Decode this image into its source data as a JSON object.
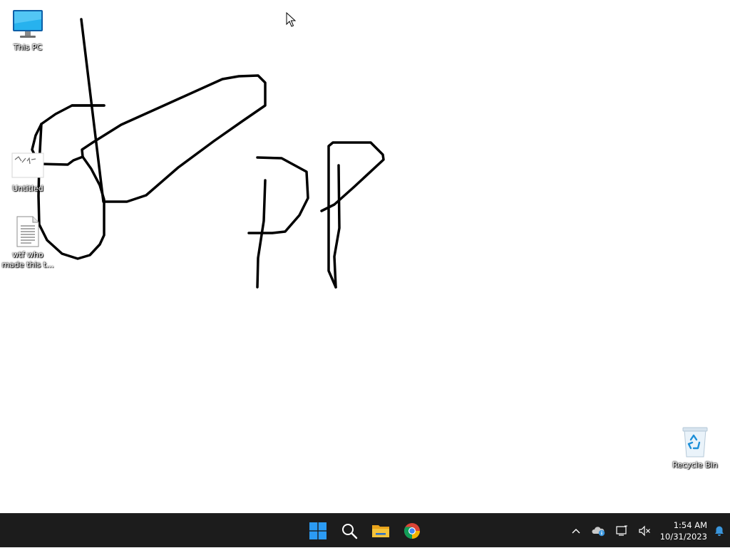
{
  "desktop": {
    "icons": [
      {
        "label": "This PC",
        "icon": "monitor-icon"
      },
      {
        "label": "Untitled",
        "icon": "paint-file-icon"
      },
      {
        "label": "wtf who made this t...",
        "icon": "text-document-icon"
      },
      {
        "label": "Recycle Bin",
        "icon": "recycle-bin-icon"
      }
    ]
  },
  "taskbar": {
    "pinned": [
      {
        "name": "Start",
        "icon": "windows-start-icon"
      },
      {
        "name": "Search",
        "icon": "search-icon"
      },
      {
        "name": "File Explorer",
        "icon": "folder-icon"
      },
      {
        "name": "Google Chrome",
        "icon": "chrome-icon"
      }
    ],
    "tray": {
      "time": "1:54 AM",
      "date": "10/31/2023"
    }
  },
  "colors": {
    "taskbar_bg": "#1c1c1c",
    "start_blue": "#2b9bf4",
    "folder_yellow": "#f4c33a",
    "notification_blue": "#3a96dd"
  }
}
